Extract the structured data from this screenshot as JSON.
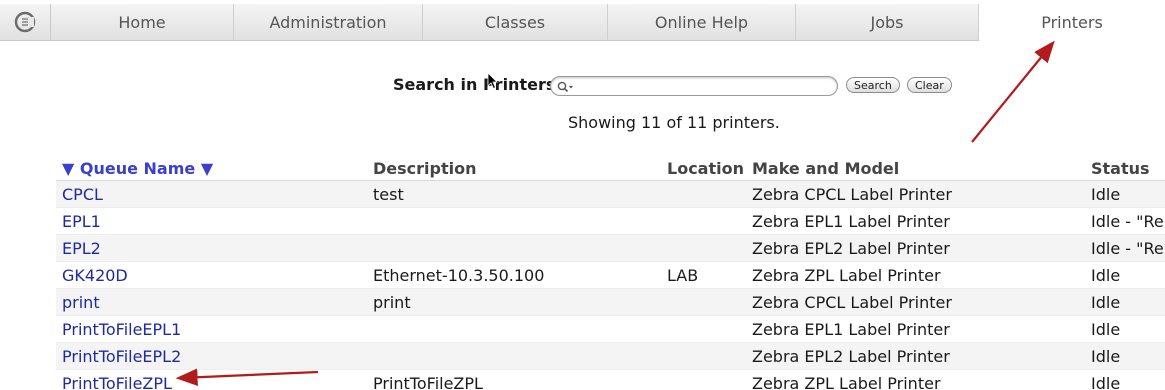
{
  "tabs": [
    {
      "label": "Home"
    },
    {
      "label": "Administration"
    },
    {
      "label": "Classes"
    },
    {
      "label": "Online Help"
    },
    {
      "label": "Jobs"
    },
    {
      "label": "Printers"
    }
  ],
  "search": {
    "label": "Search in Printers:",
    "value": "",
    "placeholder": "",
    "search_button": "Search",
    "clear_button": "Clear"
  },
  "showing_text": "Showing 11 of 11 printers.",
  "table": {
    "headers": {
      "queue_name": "▼ Queue Name ▼",
      "description": "Description",
      "location": "Location",
      "make_model": "Make and Model",
      "status": "Status"
    },
    "rows": [
      {
        "name": "CPCL",
        "description": "test",
        "location": "",
        "model": "Zebra CPCL Label Printer",
        "status": "Idle"
      },
      {
        "name": "EPL1",
        "description": "",
        "location": "",
        "model": "Zebra EPL1 Label Printer",
        "status": "Idle - \"Re"
      },
      {
        "name": "EPL2",
        "description": "",
        "location": "",
        "model": "Zebra EPL2 Label Printer",
        "status": "Idle - \"Re"
      },
      {
        "name": "GK420D",
        "description": "Ethernet-10.3.50.100",
        "location": "LAB",
        "model": "Zebra ZPL Label Printer",
        "status": "Idle"
      },
      {
        "name": "print",
        "description": "print",
        "location": "",
        "model": "Zebra CPCL Label Printer",
        "status": "Idle"
      },
      {
        "name": "PrintToFileEPL1",
        "description": "",
        "location": "",
        "model": "Zebra EPL1 Label Printer",
        "status": "Idle"
      },
      {
        "name": "PrintToFileEPL2",
        "description": "",
        "location": "",
        "model": "Zebra EPL2 Label Printer",
        "status": "Idle"
      },
      {
        "name": "PrintToFileZPL",
        "description": "PrintToFileZPL",
        "location": "",
        "model": "Zebra ZPL Label Printer",
        "status": "Idle"
      }
    ]
  },
  "colors": {
    "link": "#1f2a9e",
    "sort_header": "#3b3fc9",
    "annotation_arrow": "#b01c1c"
  },
  "icons": [
    "cups-logo-icon",
    "search-icon"
  ]
}
